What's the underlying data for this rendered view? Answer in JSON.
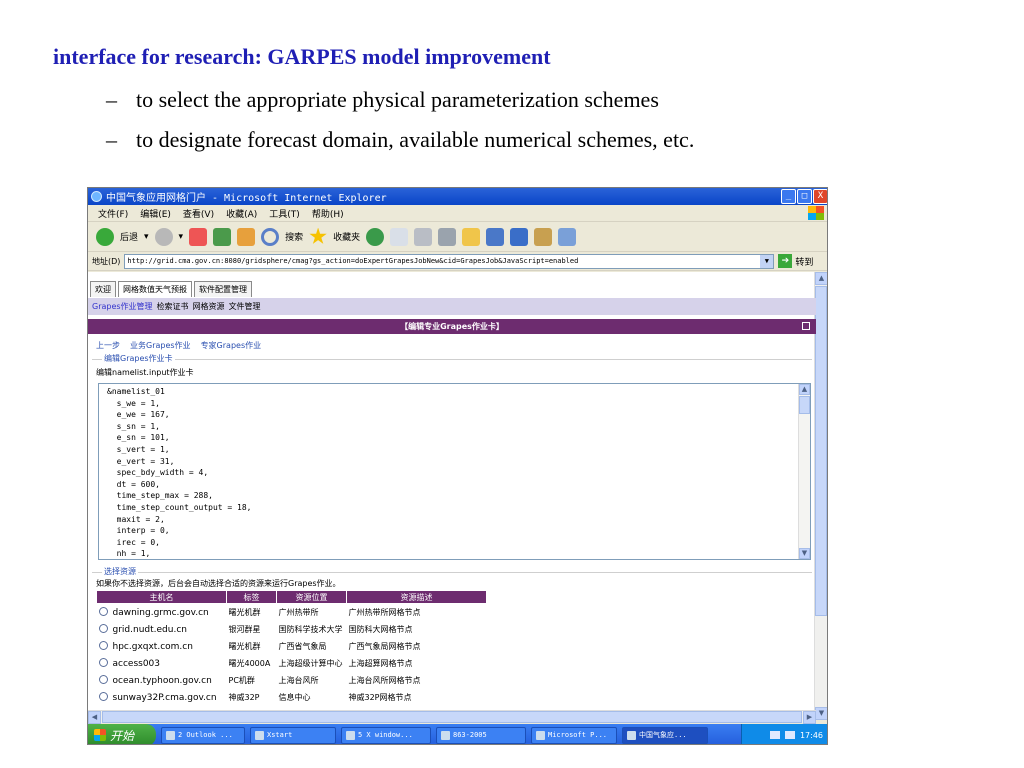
{
  "slide": {
    "title": "interface for research: GARPES model improvement",
    "bullet_dash": "–",
    "bullets": [
      "to select the appropriate physical parameterization schemes",
      "to designate forecast domain, available numerical schemes, etc."
    ]
  },
  "window": {
    "title": "中国气象应用网格门户 - Microsoft Internet Explorer",
    "controls": {
      "minimize": "_",
      "maximize": "□",
      "close": "X"
    }
  },
  "menu": [
    "文件(F)",
    "编辑(E)",
    "查看(V)",
    "收藏(A)",
    "工具(T)",
    "帮助(H)"
  ],
  "toolbar": {
    "back": "后退",
    "search": "搜索",
    "favorites": "收藏夹"
  },
  "address": {
    "label": "地址(D)",
    "url": "http://grid.cma.gov.cn:8080/gridsphere/cmag?gs_action=doExpertGrapesJobNew&cid=GrapesJob&JavaScript=enabled",
    "go": "转到"
  },
  "tabs": [
    "欢迎",
    "网格数值天气预报",
    "软件配置管理"
  ],
  "subnav": [
    "Grapes作业管理",
    "检索证书",
    "网格资源",
    "文件管理"
  ],
  "panel": {
    "title": "【编辑专业Grapes作业卡】"
  },
  "crumbs": [
    "上一步",
    "业务Grapes作业",
    "专家Grapes作业"
  ],
  "section": {
    "legend": "编辑Grapes作业卡",
    "label": "编辑namelist.input作业卡"
  },
  "namelist": [
    "&namelist_01",
    "  s_we = 1,",
    "  e_we = 167,",
    "  s_sn = 1,",
    "  e_sn = 101,",
    "  s_vert = 1,",
    "  e_vert = 31,",
    "  spec_bdy_width = 4,",
    "  dt = 600,",
    "  time_step_max = 288,",
    "  time_step_count_output = 18,",
    "  maxit = 2,",
    "  interp = 0,",
    "  irec = 0,",
    "  nh = 1,"
  ],
  "resources": {
    "legend": "选择资源",
    "note": "如果你不选择资源，后台会自动选择合适的资源来运行Grapes作业。",
    "headers": [
      "主机名",
      "标签",
      "资源位置",
      "资源描述"
    ],
    "rows": [
      {
        "host": "dawning.grmc.gov.cn",
        "tag": "曙光机群",
        "loc": "广州热带所",
        "desc": "广州热带所网格节点"
      },
      {
        "host": "grid.nudt.edu.cn",
        "tag": "银河群星",
        "loc": "国防科学技术大学",
        "desc": "国防科大网格节点"
      },
      {
        "host": "hpc.gxqxt.com.cn",
        "tag": "曙光机群",
        "loc": "广西省气象局",
        "desc": "广西气象局网格节点"
      },
      {
        "host": "access003",
        "tag": "曙光4000A",
        "loc": "上海超级计算中心",
        "desc": "上海超算网格节点"
      },
      {
        "host": "ocean.typhoon.gov.cn",
        "tag": "PC机群",
        "loc": "上海台风所",
        "desc": "上海台风所网格节点"
      },
      {
        "host": "sunway32P.cma.gov.cn",
        "tag": "神威32P",
        "loc": "信息中心",
        "desc": "神威32P网格节点"
      }
    ]
  },
  "taskbar": {
    "start": "开始",
    "tasks": [
      "2 Outlook ...",
      "Xstart",
      "5 X window...",
      "863-2005",
      "Microsoft P...",
      "中国气象应..."
    ],
    "clock": "17:46"
  },
  "colors": {
    "title": "#1f1fb4",
    "panel": "#6d2c6f",
    "taskbar": "#245ddb"
  }
}
